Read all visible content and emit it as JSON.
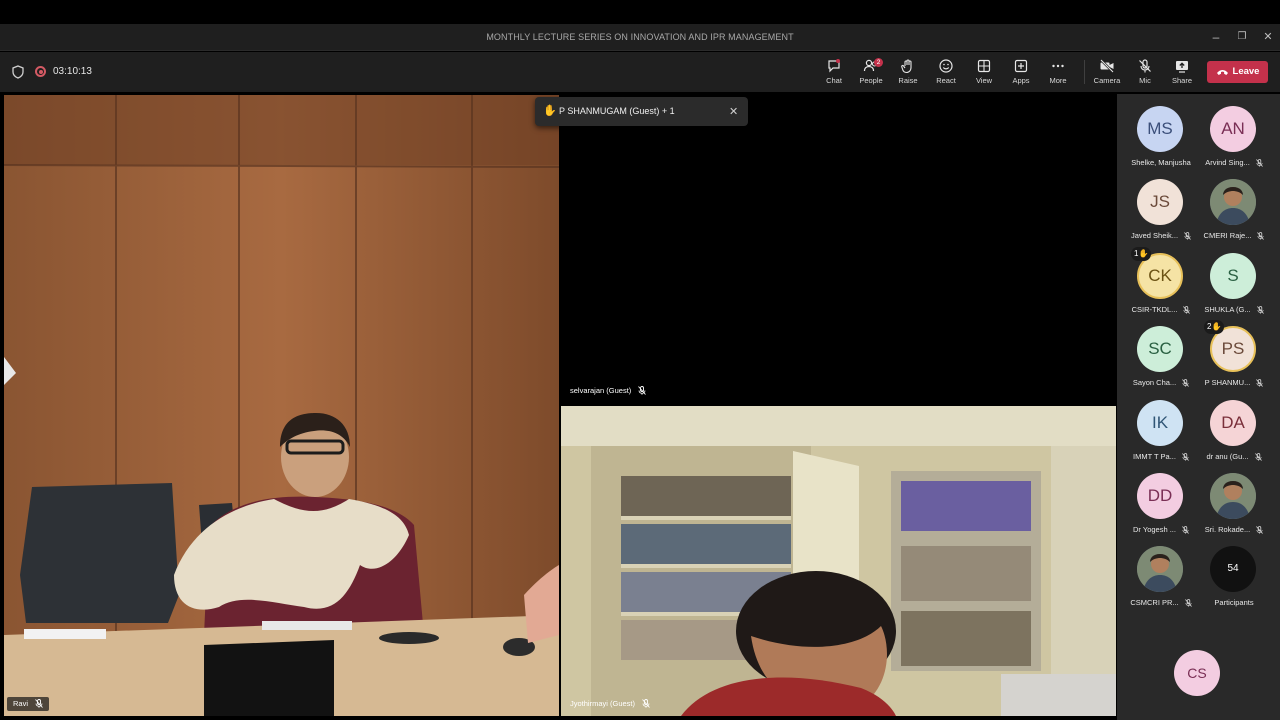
{
  "window": {
    "title": "MONTHLY LECTURE SERIES ON INNOVATION AND IPR MANAGEMENT",
    "minimize_glyph": "–",
    "restore_glyph": "❐",
    "close_glyph": "✕"
  },
  "toolbar": {
    "timer": "03:10:13",
    "chat_label": "Chat",
    "people_label": "People",
    "people_badge": "2",
    "raise_label": "Raise",
    "react_label": "React",
    "view_label": "View",
    "apps_label": "Apps",
    "more_label": "More",
    "camera_label": "Camera",
    "mic_label": "Mic",
    "share_label": "Share",
    "leave_label": "Leave",
    "accent_red": "#c4314b"
  },
  "notification": {
    "text": "P SHANMUGAM (Guest) + 1",
    "icon": "raised-hand-icon"
  },
  "tiles": {
    "ravi": "Ravi",
    "selvarajan": "selvarajan (Guest)",
    "jyothirmayi": "Jyothirmayi (Guest)"
  },
  "roster": {
    "people": [
      {
        "initials": "MS",
        "name": "Shelke, Manjusha",
        "muted": false,
        "hand": "",
        "bg": "#c7d5f2",
        "fg": "#3b4f7a"
      },
      {
        "initials": "AN",
        "name": "Arvind Sing...",
        "muted": true,
        "hand": "",
        "bg": "#f3cde1",
        "fg": "#7a2f55"
      },
      {
        "initials": "JS",
        "name": "Javed Sheik...",
        "muted": true,
        "hand": "",
        "bg": "#f1e2d8",
        "fg": "#6b4a3a"
      },
      {
        "initials": "",
        "name": "CMERI Raje...",
        "muted": true,
        "hand": "",
        "photo": true
      },
      {
        "initials": "CK",
        "name": "CSIR-TKDL...",
        "muted": true,
        "hand": "1",
        "bg": "#f5e3a5",
        "fg": "#6b5214"
      },
      {
        "initials": "S",
        "name": "SHUKLA (G...",
        "muted": true,
        "hand": "",
        "bg": "#cdeed9",
        "fg": "#2a6042"
      },
      {
        "initials": "SC",
        "name": "Sayon Cha...",
        "muted": true,
        "hand": "",
        "bg": "#cdeed9",
        "fg": "#2a6042"
      },
      {
        "initials": "PS",
        "name": "P SHANMU...",
        "muted": true,
        "hand": "2",
        "bg": "#f1e2d8",
        "fg": "#6b4a3a"
      },
      {
        "initials": "IK",
        "name": "IMMT T Pa...",
        "muted": true,
        "hand": "",
        "bg": "#cfe3f3",
        "fg": "#2f5575"
      },
      {
        "initials": "DA",
        "name": "dr anu (Gu...",
        "muted": true,
        "hand": "",
        "bg": "#f5d4d6",
        "fg": "#7a2f3a"
      },
      {
        "initials": "DD",
        "name": "Dr Yogesh ...",
        "muted": true,
        "hand": "",
        "bg": "#f3cde1",
        "fg": "#7a2f55"
      },
      {
        "initials": "",
        "name": "Sri. Rokade...",
        "muted": true,
        "hand": "",
        "photo": true
      },
      {
        "initials": "",
        "name": "CSMCRI PR...",
        "muted": true,
        "hand": "",
        "photo": true
      },
      {
        "initials": "54",
        "name": "Participants",
        "muted": false,
        "hand": "",
        "bg": "#111111",
        "fg": "#ffffff"
      }
    ],
    "self": {
      "initials": "CS",
      "bg": "#f3cde1",
      "fg": "#7a2f55"
    }
  }
}
